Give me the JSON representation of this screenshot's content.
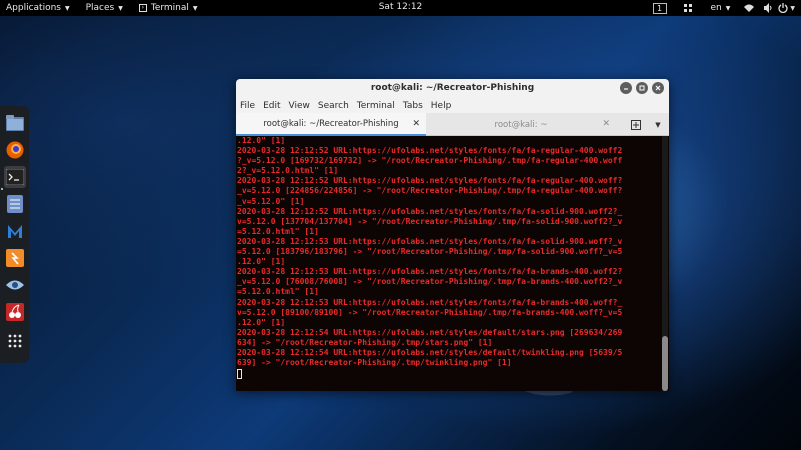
{
  "top_panel": {
    "applications": "Applications",
    "places": "Places",
    "terminal_app": "Terminal",
    "clock": "Sat 12:12",
    "workspace": "1",
    "language": "en"
  },
  "dock": {
    "items": [
      {
        "name": "files",
        "icon": "folder-icon"
      },
      {
        "name": "firefox",
        "icon": "firefox-icon"
      },
      {
        "name": "terminal",
        "icon": "terminal-icon"
      },
      {
        "name": "notes",
        "icon": "notes-icon"
      },
      {
        "name": "maltego",
        "icon": "maltego-icon"
      },
      {
        "name": "burpsuite",
        "icon": "burpsuite-icon"
      },
      {
        "name": "beef",
        "icon": "eye-icon"
      },
      {
        "name": "cherrytree",
        "icon": "cherry-icon"
      },
      {
        "name": "show-apps",
        "icon": "grid-icon"
      }
    ]
  },
  "window": {
    "title": "root@kali: ~/Recreator-Phishing",
    "menu": [
      "File",
      "Edit",
      "View",
      "Search",
      "Terminal",
      "Tabs",
      "Help"
    ],
    "tabs": [
      {
        "label": "root@kali: ~/Recreator-Phishing",
        "active": true
      },
      {
        "label": "root@kali: ~",
        "active": false
      }
    ]
  },
  "terminal": {
    "lines": [
      ".12.0\" [1]",
      "2020-03-28 12:12:52 URL:https://ufolabs.net/styles/fonts/fa/fa-regular-400.woff2",
      "?_v=5.12.0 [169732/169732] -> \"/root/Recreator-Phishing/.tmp/fa-regular-400.woff",
      "2?_v=5.12.0.html\" [1]",
      "2020-03-28 12:12:52 URL:https://ufolabs.net/styles/fonts/fa/fa-regular-400.woff?",
      "_v=5.12.0 [224856/224856] -> \"/root/Recreator-Phishing/.tmp/fa-regular-400.woff?",
      "_v=5.12.0\" [1]",
      "2020-03-28 12:12:52 URL:https://ufolabs.net/styles/fonts/fa/fa-solid-900.woff2?_",
      "v=5.12.0 [137704/137704] -> \"/root/Recreator-Phishing/.tmp/fa-solid-900.woff2?_v",
      "=5.12.0.html\" [1]",
      "2020-03-28 12:12:53 URL:https://ufolabs.net/styles/fonts/fa/fa-solid-900.woff?_v",
      "=5.12.0 [183796/183796] -> \"/root/Recreator-Phishing/.tmp/fa-solid-900.woff?_v=5",
      ".12.0\" [1]",
      "2020-03-28 12:12:53 URL:https://ufolabs.net/styles/fonts/fa/fa-brands-400.woff2?",
      "_v=5.12.0 [76008/76008] -> \"/root/Recreator-Phishing/.tmp/fa-brands-400.woff2?_v",
      "=5.12.0.html\" [1]",
      "2020-03-28 12:12:53 URL:https://ufolabs.net/styles/fonts/fa/fa-brands-400.woff?_",
      "v=5.12.0 [89100/89100] -> \"/root/Recreator-Phishing/.tmp/fa-brands-400.woff?_v=5",
      ".12.0\" [1]",
      "2020-03-28 12:12:54 URL:https://ufolabs.net/styles/default/stars.png [269634/269",
      "634] -> \"/root/Recreator-Phishing/.tmp/stars.png\" [1]",
      "2020-03-28 12:12:54 URL:https://ufolabs.net/styles/default/twinkling.png [5639/5",
      "639] -> \"/root/Recreator-Phishing/.tmp/twinkling.png\" [1]"
    ]
  }
}
